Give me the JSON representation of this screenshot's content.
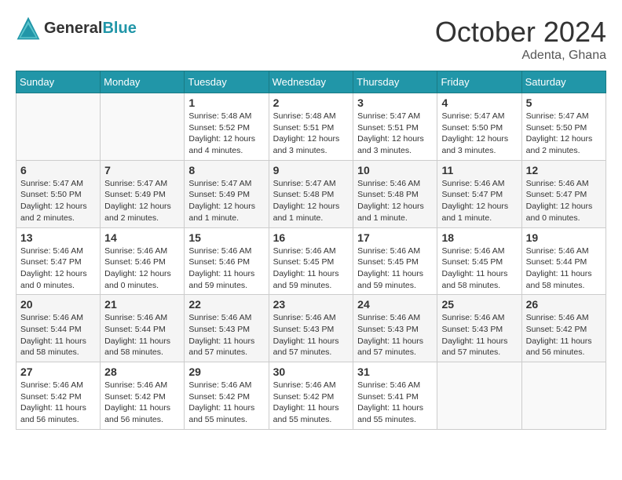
{
  "header": {
    "logo_line1": "General",
    "logo_line2": "Blue",
    "month_title": "October 2024",
    "location": "Adenta, Ghana"
  },
  "calendar": {
    "days_of_week": [
      "Sunday",
      "Monday",
      "Tuesday",
      "Wednesday",
      "Thursday",
      "Friday",
      "Saturday"
    ],
    "weeks": [
      [
        {
          "day": "",
          "info": ""
        },
        {
          "day": "",
          "info": ""
        },
        {
          "day": "1",
          "info": "Sunrise: 5:48 AM\nSunset: 5:52 PM\nDaylight: 12 hours and 4 minutes."
        },
        {
          "day": "2",
          "info": "Sunrise: 5:48 AM\nSunset: 5:51 PM\nDaylight: 12 hours and 3 minutes."
        },
        {
          "day": "3",
          "info": "Sunrise: 5:47 AM\nSunset: 5:51 PM\nDaylight: 12 hours and 3 minutes."
        },
        {
          "day": "4",
          "info": "Sunrise: 5:47 AM\nSunset: 5:50 PM\nDaylight: 12 hours and 3 minutes."
        },
        {
          "day": "5",
          "info": "Sunrise: 5:47 AM\nSunset: 5:50 PM\nDaylight: 12 hours and 2 minutes."
        }
      ],
      [
        {
          "day": "6",
          "info": "Sunrise: 5:47 AM\nSunset: 5:50 PM\nDaylight: 12 hours and 2 minutes."
        },
        {
          "day": "7",
          "info": "Sunrise: 5:47 AM\nSunset: 5:49 PM\nDaylight: 12 hours and 2 minutes."
        },
        {
          "day": "8",
          "info": "Sunrise: 5:47 AM\nSunset: 5:49 PM\nDaylight: 12 hours and 1 minute."
        },
        {
          "day": "9",
          "info": "Sunrise: 5:47 AM\nSunset: 5:48 PM\nDaylight: 12 hours and 1 minute."
        },
        {
          "day": "10",
          "info": "Sunrise: 5:46 AM\nSunset: 5:48 PM\nDaylight: 12 hours and 1 minute."
        },
        {
          "day": "11",
          "info": "Sunrise: 5:46 AM\nSunset: 5:47 PM\nDaylight: 12 hours and 1 minute."
        },
        {
          "day": "12",
          "info": "Sunrise: 5:46 AM\nSunset: 5:47 PM\nDaylight: 12 hours and 0 minutes."
        }
      ],
      [
        {
          "day": "13",
          "info": "Sunrise: 5:46 AM\nSunset: 5:47 PM\nDaylight: 12 hours and 0 minutes."
        },
        {
          "day": "14",
          "info": "Sunrise: 5:46 AM\nSunset: 5:46 PM\nDaylight: 12 hours and 0 minutes."
        },
        {
          "day": "15",
          "info": "Sunrise: 5:46 AM\nSunset: 5:46 PM\nDaylight: 11 hours and 59 minutes."
        },
        {
          "day": "16",
          "info": "Sunrise: 5:46 AM\nSunset: 5:45 PM\nDaylight: 11 hours and 59 minutes."
        },
        {
          "day": "17",
          "info": "Sunrise: 5:46 AM\nSunset: 5:45 PM\nDaylight: 11 hours and 59 minutes."
        },
        {
          "day": "18",
          "info": "Sunrise: 5:46 AM\nSunset: 5:45 PM\nDaylight: 11 hours and 58 minutes."
        },
        {
          "day": "19",
          "info": "Sunrise: 5:46 AM\nSunset: 5:44 PM\nDaylight: 11 hours and 58 minutes."
        }
      ],
      [
        {
          "day": "20",
          "info": "Sunrise: 5:46 AM\nSunset: 5:44 PM\nDaylight: 11 hours and 58 minutes."
        },
        {
          "day": "21",
          "info": "Sunrise: 5:46 AM\nSunset: 5:44 PM\nDaylight: 11 hours and 58 minutes."
        },
        {
          "day": "22",
          "info": "Sunrise: 5:46 AM\nSunset: 5:43 PM\nDaylight: 11 hours and 57 minutes."
        },
        {
          "day": "23",
          "info": "Sunrise: 5:46 AM\nSunset: 5:43 PM\nDaylight: 11 hours and 57 minutes."
        },
        {
          "day": "24",
          "info": "Sunrise: 5:46 AM\nSunset: 5:43 PM\nDaylight: 11 hours and 57 minutes."
        },
        {
          "day": "25",
          "info": "Sunrise: 5:46 AM\nSunset: 5:43 PM\nDaylight: 11 hours and 57 minutes."
        },
        {
          "day": "26",
          "info": "Sunrise: 5:46 AM\nSunset: 5:42 PM\nDaylight: 11 hours and 56 minutes."
        }
      ],
      [
        {
          "day": "27",
          "info": "Sunrise: 5:46 AM\nSunset: 5:42 PM\nDaylight: 11 hours and 56 minutes."
        },
        {
          "day": "28",
          "info": "Sunrise: 5:46 AM\nSunset: 5:42 PM\nDaylight: 11 hours and 56 minutes."
        },
        {
          "day": "29",
          "info": "Sunrise: 5:46 AM\nSunset: 5:42 PM\nDaylight: 11 hours and 55 minutes."
        },
        {
          "day": "30",
          "info": "Sunrise: 5:46 AM\nSunset: 5:42 PM\nDaylight: 11 hours and 55 minutes."
        },
        {
          "day": "31",
          "info": "Sunrise: 5:46 AM\nSunset: 5:41 PM\nDaylight: 11 hours and 55 minutes."
        },
        {
          "day": "",
          "info": ""
        },
        {
          "day": "",
          "info": ""
        }
      ]
    ]
  }
}
